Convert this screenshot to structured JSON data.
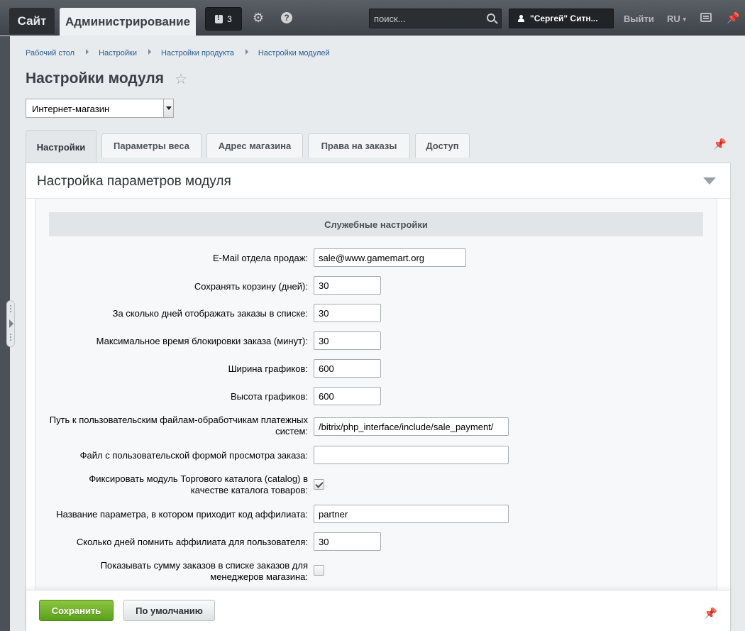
{
  "topbar": {
    "site_label": "Сайт",
    "admin_label": "Администрирование",
    "notifications_count": "3",
    "search_placeholder": "поиск...",
    "user_name": "\"Сергей\" Ситн...",
    "logout_label": "Выйти",
    "lang_label": "RU"
  },
  "breadcrumb": [
    "Рабочий стол",
    "Настройки",
    "Настройки продукта",
    "Настройки модулей"
  ],
  "page_title": "Настройки модуля",
  "module_select": {
    "value": "Интернет-магазин"
  },
  "tabs": [
    {
      "label": "Настройки",
      "active": true
    },
    {
      "label": "Параметры веса",
      "active": false
    },
    {
      "label": "Адрес магазина",
      "active": false
    },
    {
      "label": "Права на заказы",
      "active": false
    },
    {
      "label": "Доступ",
      "active": false
    }
  ],
  "panel_title": "Настройка параметров модуля",
  "section_title": "Служебные настройки",
  "fields": [
    {
      "label": "E-Mail отдела продаж:",
      "type": "text",
      "value": "sale@www.gamemart.org"
    },
    {
      "label": "Сохранять корзину (дней):",
      "type": "text",
      "value": "30"
    },
    {
      "label": "За сколько дней отображать заказы в списке:",
      "type": "text",
      "value": "30"
    },
    {
      "label": "Максимальное время блокировки заказа (минут):",
      "type": "text",
      "value": "30"
    },
    {
      "label": "Ширина графиков:",
      "type": "text",
      "value": "600"
    },
    {
      "label": "Высота графиков:",
      "type": "text",
      "value": "600"
    },
    {
      "label": "Путь к пользовательским файлам-обработчикам платежных систем:",
      "type": "text",
      "value": "/bitrix/php_interface/include/sale_payment/"
    },
    {
      "label": "Файл с пользовательской формой просмотра заказа:",
      "type": "text",
      "value": ""
    },
    {
      "label": "Фиксировать модуль Торгового каталога (catalog) в качестве каталога товаров:",
      "type": "checkbox",
      "checked": true
    },
    {
      "label": "Название параметра, в котором приходит код аффилиата:",
      "type": "text",
      "value": "partner"
    },
    {
      "label": "Сколько дней помнить аффилиата для пользователя:",
      "type": "text",
      "value": "30"
    },
    {
      "label": "Показывать сумму заказов в списке заказов для менеджеров магазина:",
      "type": "checkbox",
      "checked": false
    }
  ],
  "actions": {
    "save_label": "Сохранить",
    "default_label": "По умолчанию"
  },
  "colors": {
    "save_button": "#5aa01c",
    "topbar": "#3f434a",
    "link": "#2b5d94"
  }
}
